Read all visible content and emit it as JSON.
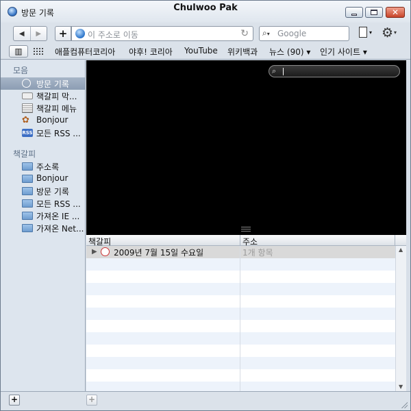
{
  "window": {
    "title": "방문 기록",
    "user": "Chulwoo Pak"
  },
  "toolbar": {
    "back_icon": "◀",
    "forward_icon": "▶",
    "add_icon": "+",
    "address_placeholder": "이 주소로 이동",
    "reload_icon": "↻",
    "search_placeholder": "Google",
    "search_icon": "🔍",
    "search_arrow": "▾",
    "gear_icon": "⚙",
    "menu_arrow": "▾"
  },
  "bookmarks_bar": {
    "book_icon": "📖",
    "items": [
      "애플컴퓨터코리아",
      "야후! 코리아",
      "YouTube",
      "위키백과",
      "뉴스 (90) ▾",
      "인기 사이트 ▾"
    ]
  },
  "sidebar": {
    "collections_header": "모음",
    "collections": [
      {
        "label": "방문 기록",
        "icon": "clock-icon",
        "selected": true
      },
      {
        "label": "책갈피 막...",
        "icon": "bookmarks-bar-icon"
      },
      {
        "label": "책갈피 메뉴",
        "icon": "bookmarks-menu-icon"
      },
      {
        "label": "Bonjour",
        "icon": "bonjour-icon"
      },
      {
        "label": "모든 RSS ...",
        "icon": "rss-icon",
        "icon_text": "RSS"
      }
    ],
    "bookmarks_header": "책갈피",
    "bookmarks": [
      {
        "label": "주소록"
      },
      {
        "label": "Bonjour"
      },
      {
        "label": "방문 기록"
      },
      {
        "label": "모든 RSS ..."
      },
      {
        "label": "가져온 IE ..."
      },
      {
        "label": "가져온 Net..."
      }
    ]
  },
  "coverflow": {
    "search_icon": "🔍"
  },
  "list": {
    "columns": [
      "책갈피",
      "주소"
    ],
    "rows": [
      {
        "expander": "▶",
        "title": "2009년 7월 15일 수요일",
        "address": "1개 항목"
      }
    ],
    "scroll_up": "▲",
    "scroll_down": "▼"
  },
  "bottom": {
    "add_label": "+"
  },
  "colors": {
    "selection": "#8c9db3",
    "coverflow_bg": "#000000",
    "row_stripe": "#edf3fb"
  }
}
